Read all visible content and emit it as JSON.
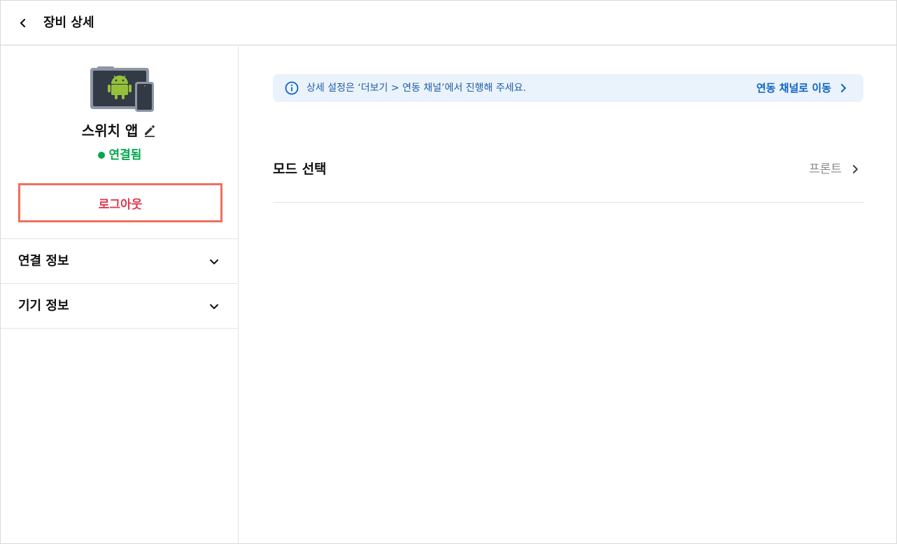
{
  "header": {
    "title": "장비 상세",
    "back_icon": "chevron-left-icon"
  },
  "device": {
    "name": "스위치 앱",
    "status": "연결됨",
    "status_color": "#03a84e",
    "icon": "android-tablet-phone-icon",
    "edit_icon": "pencil-icon"
  },
  "sidebar": {
    "logout_label": "로그아웃",
    "logout_color": "#e0394f",
    "sections": [
      {
        "label": "연결 정보",
        "icon": "chevron-down-icon"
      },
      {
        "label": "기기 정보",
        "icon": "chevron-down-icon"
      }
    ]
  },
  "main": {
    "banner": {
      "text": "상세 설정은 ‘더보기 > 연동 채널’에서 진행해 주세요.",
      "link_label": "연동 채널로 이동",
      "icon": "info-icon",
      "background": "#eaf2fb"
    },
    "mode": {
      "label": "모드 선택",
      "value": "프론트"
    }
  }
}
